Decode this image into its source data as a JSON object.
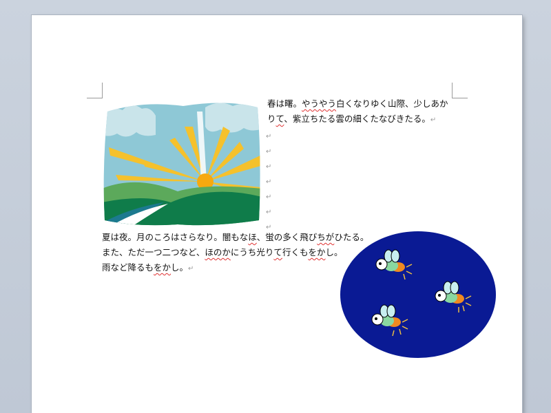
{
  "document": {
    "para1": {
      "line1": {
        "a": "春は曙。",
        "b": "やうやう",
        "c": "白くなりゆく山際、少しあか"
      },
      "line2": {
        "a": "り",
        "b": "て",
        "c": "、紫立ちたる雲の細くたなびきたる。"
      }
    },
    "para2": {
      "line1": {
        "a": "夏は夜。月のころはさらなり。闇もな",
        "b": "ほ",
        "c": "、蛍の多く飛び",
        "d": "ちが",
        "e": "ひたる。"
      },
      "line2": {
        "a": "また、ただ一つ二つなど、",
        "b": "ほのか",
        "c": "にうち光り",
        "d": "て",
        "e": "行くも",
        "f": "をか",
        "g": "し。"
      },
      "line3": {
        "a": "雨など降るも",
        "b": "をか",
        "c": "し。"
      }
    },
    "paragraph_mark": "↵"
  },
  "colors": {
    "sky": "#8ec8d6",
    "cloud": "#c9e4ea",
    "sun": "#f5c12c",
    "hill_dark": "#0f7c4a",
    "hill_light": "#5ca95b",
    "night": "#0a1a94",
    "firefly_glow": "#f0c040",
    "spell_error": "#e03030"
  },
  "images": {
    "sunrise_icon": "sunrise-clipart",
    "fireflies_icon": "fireflies-clipart"
  }
}
